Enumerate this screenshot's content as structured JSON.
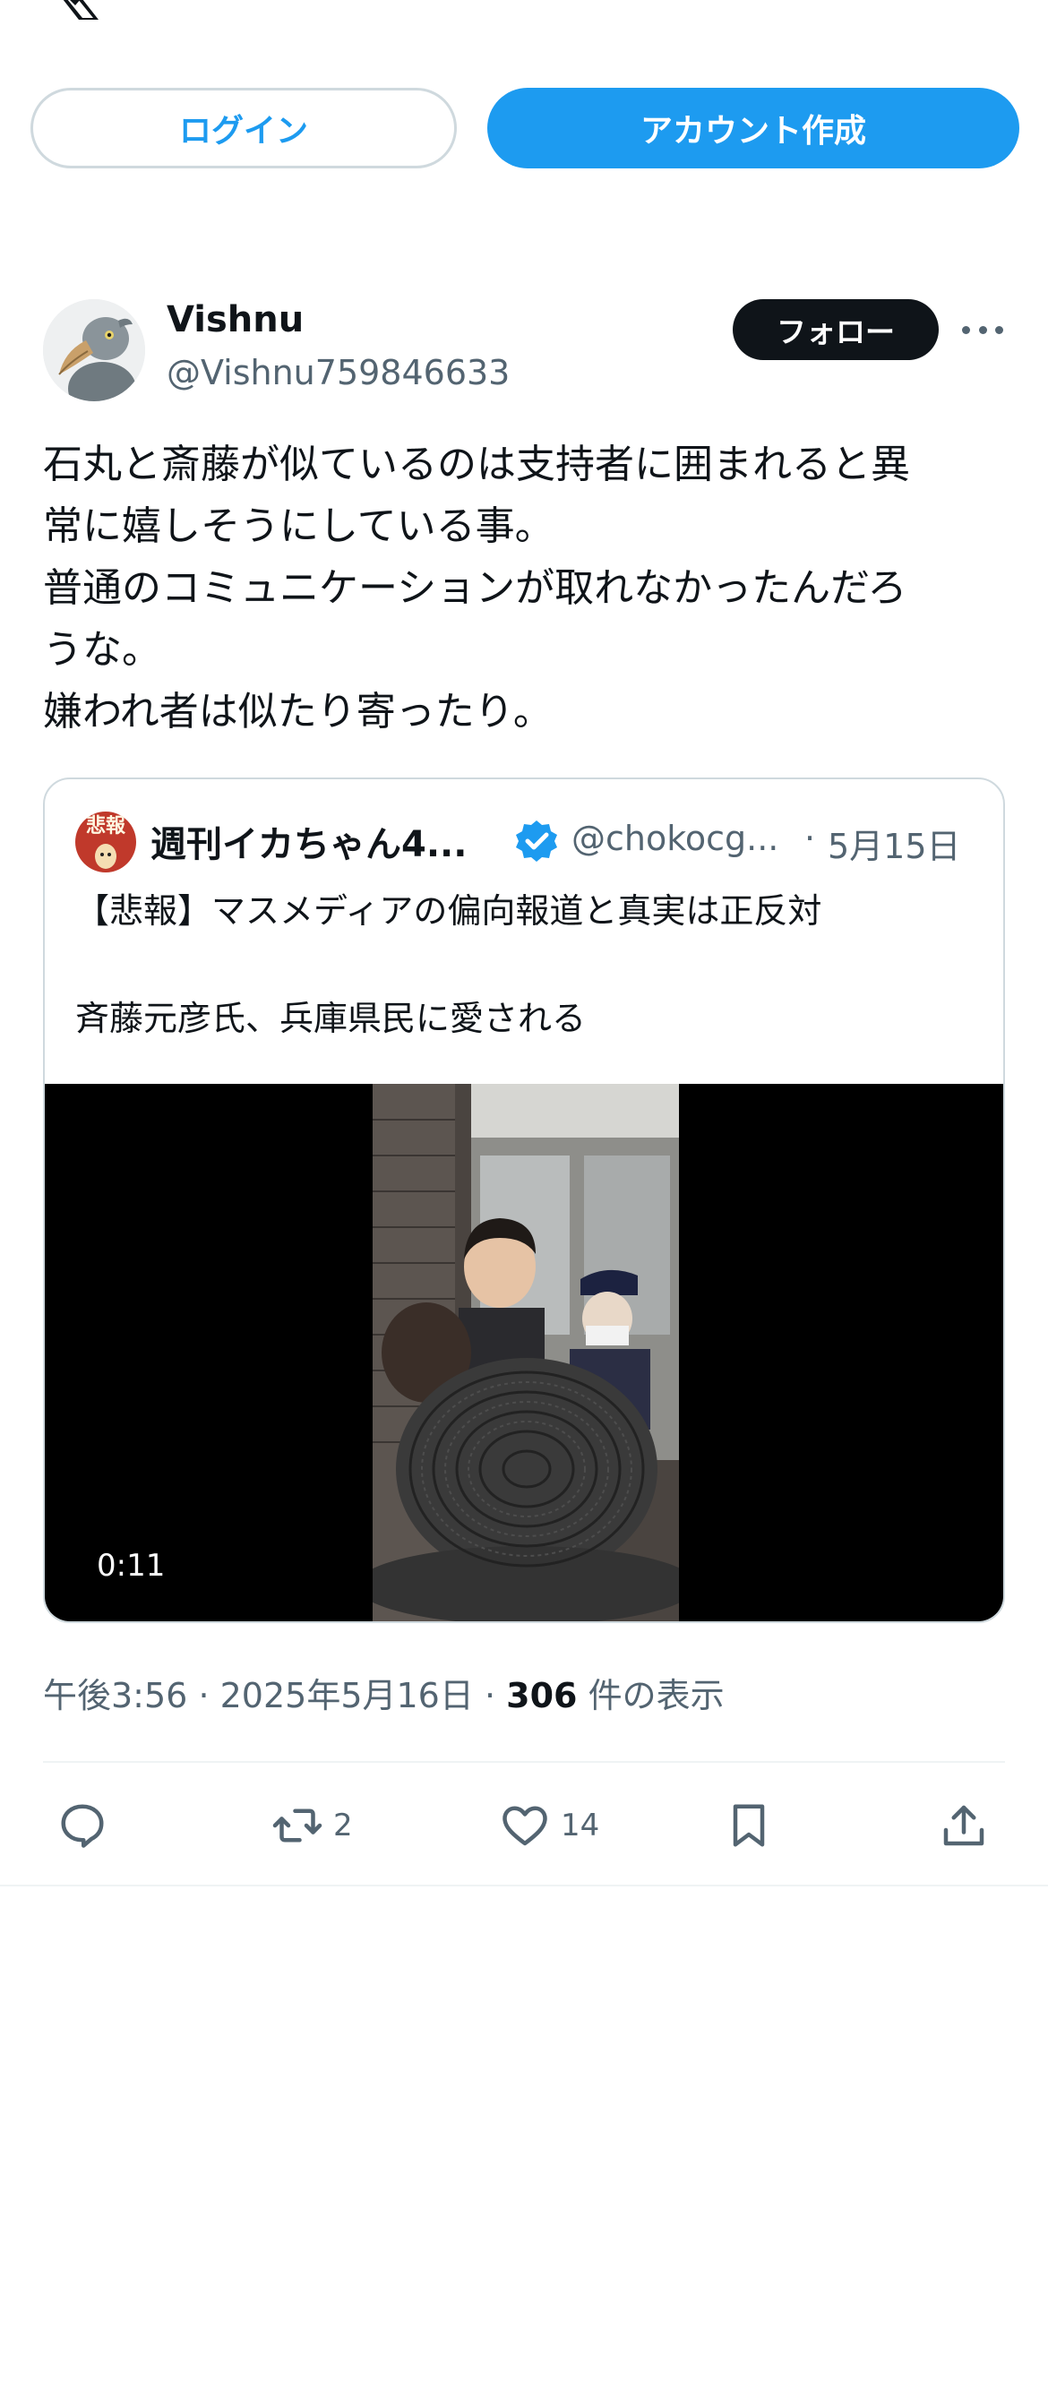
{
  "nav": {
    "logo": "x-logo"
  },
  "auth": {
    "login_label": "ログイン",
    "signup_label": "アカウント作成"
  },
  "tweet": {
    "author_name": "Vishnu",
    "author_handle": "@Vishnu759846633",
    "follow_label": "フォロー",
    "text_lines": [
      "石丸と斎藤が似ているのは支持者に囲まれると異",
      "常に嬉しそうにしている事。",
      "普通のコミュニケーションが取れなかったんだろ",
      "うな。",
      "嫌われ者は似たり寄ったり。"
    ],
    "time": "午後3:56",
    "date": "2025年5月16日",
    "view_count": "306",
    "view_label": "件の表示"
  },
  "quote": {
    "avatar_text": "悲報",
    "name": "週刊イカちゃん4...",
    "handle": "@chokocg...",
    "separator": "·",
    "date": "5月15日",
    "line1": "【悲報】マスメディアの偏向報道と真実は正反対",
    "line2": "斉藤元彦氏、兵庫県民に愛される",
    "video_duration": "0:11"
  },
  "actions": {
    "reply_icon": "reply-icon",
    "retweet_count": "2",
    "like_count": "14",
    "bookmark_icon": "bookmark-icon",
    "share_icon": "share-icon"
  },
  "colors": {
    "accent": "#1d9bf0",
    "text": "#0f1419",
    "muted": "#536471",
    "border": "#cfd9de"
  }
}
